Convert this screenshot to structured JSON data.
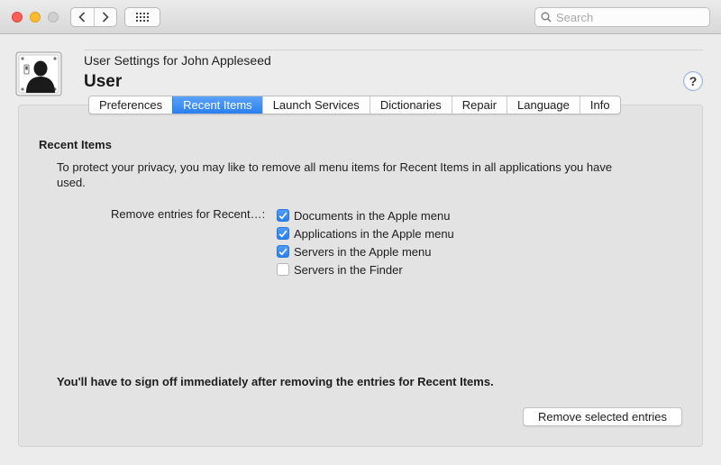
{
  "toolbar": {
    "search_placeholder": "Search",
    "back_icon": "chevron-left-icon",
    "forward_icon": "chevron-right-icon",
    "grid_icon": "grid-icon"
  },
  "header": {
    "subtitle": "User Settings for John Appleseed",
    "title": "User",
    "help_label": "?"
  },
  "tabs": [
    {
      "label": "Preferences",
      "active": false
    },
    {
      "label": "Recent Items",
      "active": true
    },
    {
      "label": "Launch Services",
      "active": false
    },
    {
      "label": "Dictionaries",
      "active": false
    },
    {
      "label": "Repair",
      "active": false
    },
    {
      "label": "Language",
      "active": false
    },
    {
      "label": "Info",
      "active": false
    }
  ],
  "content": {
    "section_title": "Recent Items",
    "description": "To protect your privacy, you may like to remove all menu items for Recent Items in all applications you have used.",
    "remove_label": "Remove entries for Recent…:",
    "options": [
      {
        "label": "Documents in the Apple menu",
        "checked": true
      },
      {
        "label": "Applications in the Apple menu",
        "checked": true
      },
      {
        "label": "Servers in the Apple menu",
        "checked": true
      },
      {
        "label": "Servers in the Finder",
        "checked": false
      }
    ],
    "warning": "You'll have to sign off immediately after removing the entries for Recent Items.",
    "remove_button": "Remove selected entries"
  },
  "colors": {
    "accent": "#2a7ff0",
    "close": "#fd5f57",
    "minimize": "#febb2d"
  }
}
